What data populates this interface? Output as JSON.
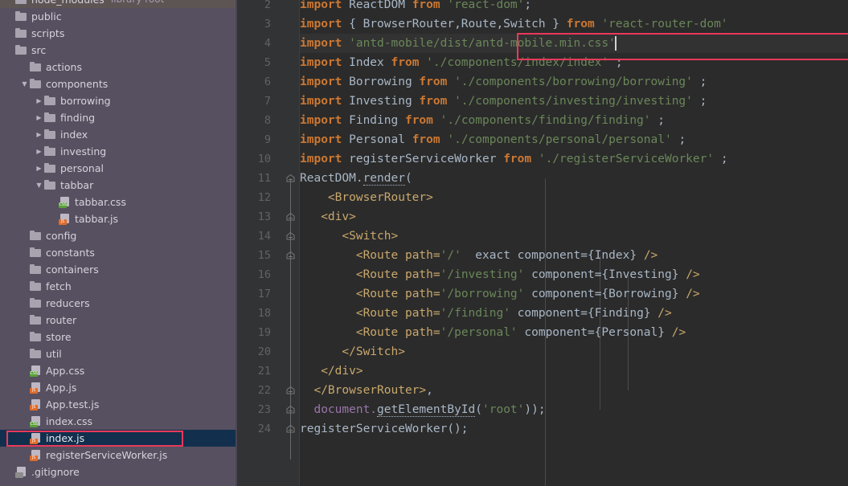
{
  "sidebar": {
    "name": "project-tree",
    "rows": [
      {
        "indent": 0,
        "twisty": "none",
        "icon": "folder-icon",
        "label": "node_modules",
        "sub": "library root",
        "state": "library-root",
        "partial_top": true
      },
      {
        "indent": 0,
        "twisty": "none",
        "icon": "folder-icon",
        "label": "public",
        "sub": "",
        "state": "normal"
      },
      {
        "indent": 0,
        "twisty": "none",
        "icon": "folder-icon",
        "label": "scripts",
        "sub": "",
        "state": "normal"
      },
      {
        "indent": 0,
        "twisty": "none",
        "icon": "folder-icon",
        "label": "src",
        "sub": "",
        "state": "normal"
      },
      {
        "indent": 1,
        "twisty": "none",
        "icon": "folder-icon",
        "label": "actions",
        "sub": "",
        "state": "normal"
      },
      {
        "indent": 1,
        "twisty": "expanded",
        "icon": "folder-icon",
        "label": "components",
        "sub": "",
        "state": "normal"
      },
      {
        "indent": 2,
        "twisty": "collapsed",
        "icon": "folder-icon",
        "label": "borrowing",
        "sub": "",
        "state": "normal"
      },
      {
        "indent": 2,
        "twisty": "collapsed",
        "icon": "folder-icon",
        "label": "finding",
        "sub": "",
        "state": "normal"
      },
      {
        "indent": 2,
        "twisty": "collapsed",
        "icon": "folder-icon",
        "label": "index",
        "sub": "",
        "state": "normal"
      },
      {
        "indent": 2,
        "twisty": "collapsed",
        "icon": "folder-icon",
        "label": "investing",
        "sub": "",
        "state": "normal"
      },
      {
        "indent": 2,
        "twisty": "collapsed",
        "icon": "folder-icon",
        "label": "personal",
        "sub": "",
        "state": "normal"
      },
      {
        "indent": 2,
        "twisty": "expanded",
        "icon": "folder-icon",
        "label": "tabbar",
        "sub": "",
        "state": "normal"
      },
      {
        "indent": 3,
        "twisty": "none",
        "icon": "css-file-icon",
        "label": "tabbar.css",
        "sub": "",
        "state": "normal"
      },
      {
        "indent": 3,
        "twisty": "none",
        "icon": "js-file-icon",
        "label": "tabbar.js",
        "sub": "",
        "state": "normal"
      },
      {
        "indent": 1,
        "twisty": "none",
        "icon": "folder-icon",
        "label": "config",
        "sub": "",
        "state": "normal"
      },
      {
        "indent": 1,
        "twisty": "none",
        "icon": "folder-icon",
        "label": "constants",
        "sub": "",
        "state": "normal"
      },
      {
        "indent": 1,
        "twisty": "none",
        "icon": "folder-icon",
        "label": "containers",
        "sub": "",
        "state": "normal"
      },
      {
        "indent": 1,
        "twisty": "none",
        "icon": "folder-icon",
        "label": "fetch",
        "sub": "",
        "state": "normal"
      },
      {
        "indent": 1,
        "twisty": "none",
        "icon": "folder-icon",
        "label": "reducers",
        "sub": "",
        "state": "normal"
      },
      {
        "indent": 1,
        "twisty": "none",
        "icon": "folder-icon",
        "label": "router",
        "sub": "",
        "state": "normal"
      },
      {
        "indent": 1,
        "twisty": "none",
        "icon": "folder-icon",
        "label": "store",
        "sub": "",
        "state": "normal"
      },
      {
        "indent": 1,
        "twisty": "none",
        "icon": "folder-icon",
        "label": "util",
        "sub": "",
        "state": "normal"
      },
      {
        "indent": 1,
        "twisty": "none",
        "icon": "css-file-icon",
        "label": "App.css",
        "sub": "",
        "state": "normal"
      },
      {
        "indent": 1,
        "twisty": "none",
        "icon": "js-file-icon",
        "label": "App.js",
        "sub": "",
        "state": "normal"
      },
      {
        "indent": 1,
        "twisty": "none",
        "icon": "js-test-file-icon",
        "label": "App.test.js",
        "sub": "",
        "state": "normal"
      },
      {
        "indent": 1,
        "twisty": "none",
        "icon": "css-file-icon",
        "label": "index.css",
        "sub": "",
        "state": "normal"
      },
      {
        "indent": 1,
        "twisty": "none",
        "icon": "js-file-icon",
        "label": "index.js",
        "sub": "",
        "state": "selected"
      },
      {
        "indent": 1,
        "twisty": "none",
        "icon": "js-file-icon",
        "label": "registerServiceWorker.js",
        "sub": "",
        "state": "normal"
      },
      {
        "indent": 0,
        "twisty": "none",
        "icon": "file-icon",
        "label": ".gitignore",
        "sub": "",
        "state": "normal",
        "partial_bottom": true
      }
    ],
    "annotation": {
      "name": "tree-selection-annotation",
      "color": "#e8395b"
    }
  },
  "editor": {
    "name": "code-editor",
    "first_visible_line": 2,
    "caret_line": 4,
    "annotation": {
      "name": "code-line-annotation",
      "color": "#e8395b",
      "line": 4
    },
    "lines": [
      {
        "no": "2",
        "tokens": [
          {
            "t": "kw",
            "v": "import"
          },
          {
            "t": "def",
            "v": " ReactDOM "
          },
          {
            "t": "kw",
            "v": "from"
          },
          {
            "t": "def",
            "v": " "
          },
          {
            "t": "str",
            "v": "'react-dom'"
          },
          {
            "t": "punc",
            "v": ";"
          }
        ]
      },
      {
        "no": "3",
        "tokens": [
          {
            "t": "kw",
            "v": "import"
          },
          {
            "t": "def",
            "v": " { BrowserRouter,Route,Switch } "
          },
          {
            "t": "kw",
            "v": "from"
          },
          {
            "t": "def",
            "v": " "
          },
          {
            "t": "str",
            "v": "'react-router-dom'"
          }
        ]
      },
      {
        "no": "4",
        "tokens": [
          {
            "t": "kw",
            "v": "import"
          },
          {
            "t": "def",
            "v": " "
          },
          {
            "t": "str",
            "v": "'antd-mobile/dist/antd-mobile.min.css'"
          }
        ]
      },
      {
        "no": "5",
        "tokens": [
          {
            "t": "kw",
            "v": "import"
          },
          {
            "t": "def",
            "v": " Index "
          },
          {
            "t": "kw",
            "v": "from"
          },
          {
            "t": "def",
            "v": " "
          },
          {
            "t": "str",
            "v": "'./components/index/index'"
          },
          {
            "t": "punc",
            "v": " ;"
          }
        ]
      },
      {
        "no": "6",
        "tokens": [
          {
            "t": "kw",
            "v": "import"
          },
          {
            "t": "def",
            "v": " Borrowing "
          },
          {
            "t": "kw",
            "v": "from"
          },
          {
            "t": "def",
            "v": " "
          },
          {
            "t": "str",
            "v": "'./components/borrowing/borrowing'"
          },
          {
            "t": "punc",
            "v": " ;"
          }
        ]
      },
      {
        "no": "7",
        "tokens": [
          {
            "t": "kw",
            "v": "import"
          },
          {
            "t": "def",
            "v": " Investing "
          },
          {
            "t": "kw",
            "v": "from"
          },
          {
            "t": "def",
            "v": " "
          },
          {
            "t": "str",
            "v": "'./components/investing/investing'"
          },
          {
            "t": "punc",
            "v": " ;"
          }
        ]
      },
      {
        "no": "8",
        "tokens": [
          {
            "t": "kw",
            "v": "import"
          },
          {
            "t": "def",
            "v": " Finding "
          },
          {
            "t": "kw",
            "v": "from"
          },
          {
            "t": "def",
            "v": " "
          },
          {
            "t": "str",
            "v": "'./components/finding/finding'"
          },
          {
            "t": "punc",
            "v": " ;"
          }
        ]
      },
      {
        "no": "9",
        "tokens": [
          {
            "t": "kw",
            "v": "import"
          },
          {
            "t": "def",
            "v": " Personal "
          },
          {
            "t": "kw",
            "v": "from"
          },
          {
            "t": "def",
            "v": " "
          },
          {
            "t": "str",
            "v": "'./components/personal/personal'"
          },
          {
            "t": "punc",
            "v": " ;"
          }
        ]
      },
      {
        "no": "10",
        "tokens": [
          {
            "t": "kw",
            "v": "import"
          },
          {
            "t": "def",
            "v": " registerServiceWorker "
          },
          {
            "t": "kw",
            "v": "from"
          },
          {
            "t": "def",
            "v": " "
          },
          {
            "t": "str",
            "v": "'./registerServiceWorker'"
          },
          {
            "t": "punc",
            "v": " ;"
          }
        ]
      },
      {
        "no": "11",
        "tokens": [
          {
            "t": "def",
            "v": "ReactDOM."
          },
          {
            "t": "wavy",
            "v": "render"
          },
          {
            "t": "punc",
            "v": "("
          }
        ]
      },
      {
        "no": "12",
        "tokens": [
          {
            "t": "def",
            "v": "    "
          },
          {
            "t": "tag",
            "v": "<BrowserRouter>"
          }
        ]
      },
      {
        "no": "13",
        "tokens": [
          {
            "t": "def",
            "v": "   "
          },
          {
            "t": "tag",
            "v": "<div>"
          }
        ]
      },
      {
        "no": "14",
        "tokens": [
          {
            "t": "def",
            "v": "      "
          },
          {
            "t": "tag",
            "v": "<Switch>"
          }
        ]
      },
      {
        "no": "15",
        "tokens": [
          {
            "t": "def",
            "v": "        "
          },
          {
            "t": "tag",
            "v": "<Route"
          },
          {
            "t": "def",
            "v": " "
          },
          {
            "t": "tag",
            "v": "path="
          },
          {
            "t": "str",
            "v": "'/'"
          },
          {
            "t": "def",
            "v": "  exact component={Index} "
          },
          {
            "t": "tag",
            "v": "/>"
          }
        ]
      },
      {
        "no": "16",
        "tokens": [
          {
            "t": "def",
            "v": "        "
          },
          {
            "t": "tag",
            "v": "<Route"
          },
          {
            "t": "def",
            "v": " "
          },
          {
            "t": "tag",
            "v": "path="
          },
          {
            "t": "str",
            "v": "'/investing'"
          },
          {
            "t": "def",
            "v": " component={Investing} "
          },
          {
            "t": "tag",
            "v": "/>"
          }
        ]
      },
      {
        "no": "17",
        "tokens": [
          {
            "t": "def",
            "v": "        "
          },
          {
            "t": "tag",
            "v": "<Route"
          },
          {
            "t": "def",
            "v": " "
          },
          {
            "t": "tag",
            "v": "path="
          },
          {
            "t": "str",
            "v": "'/borrowing'"
          },
          {
            "t": "def",
            "v": " component={Borrowing} "
          },
          {
            "t": "tag",
            "v": "/>"
          }
        ]
      },
      {
        "no": "18",
        "tokens": [
          {
            "t": "def",
            "v": "        "
          },
          {
            "t": "tag",
            "v": "<Route"
          },
          {
            "t": "def",
            "v": " "
          },
          {
            "t": "tag",
            "v": "path="
          },
          {
            "t": "str",
            "v": "'/finding'"
          },
          {
            "t": "def",
            "v": " component={Finding} "
          },
          {
            "t": "tag",
            "v": "/>"
          }
        ]
      },
      {
        "no": "19",
        "tokens": [
          {
            "t": "def",
            "v": "        "
          },
          {
            "t": "tag",
            "v": "<Route"
          },
          {
            "t": "def",
            "v": " "
          },
          {
            "t": "tag",
            "v": "path="
          },
          {
            "t": "str",
            "v": "'/personal'"
          },
          {
            "t": "def",
            "v": " component={Personal} "
          },
          {
            "t": "tag",
            "v": "/>"
          }
        ]
      },
      {
        "no": "20",
        "tokens": [
          {
            "t": "def",
            "v": "      "
          },
          {
            "t": "tag",
            "v": "</Switch>"
          }
        ]
      },
      {
        "no": "21",
        "tokens": [
          {
            "t": "def",
            "v": "   "
          },
          {
            "t": "tag",
            "v": "</div>"
          }
        ]
      },
      {
        "no": "22",
        "tokens": [
          {
            "t": "def",
            "v": "  "
          },
          {
            "t": "tag",
            "v": "</BrowserRouter>"
          },
          {
            "t": "punc",
            "v": ","
          }
        ]
      },
      {
        "no": "23",
        "tokens": [
          {
            "t": "def",
            "v": "  "
          },
          {
            "t": "obj",
            "v": "document."
          },
          {
            "t": "wavy",
            "v": "getElementById"
          },
          {
            "t": "punc",
            "v": "("
          },
          {
            "t": "str",
            "v": "'root'"
          },
          {
            "t": "punc",
            "v": "));"
          }
        ]
      },
      {
        "no": "24",
        "tokens": [
          {
            "t": "def",
            "v": "registerServiceWorker"
          },
          {
            "t": "punc",
            "v": "();"
          }
        ]
      }
    ]
  },
  "colors": {
    "sidebar_bg": "#575060",
    "editor_bg": "#2b2b2b",
    "gutter_bg": "#313335",
    "selection_bg": "#12304d",
    "annotation_red": "#e8395b",
    "keyword_orange": "#cc7832",
    "string_green": "#6a8759",
    "tag_gold": "#c9a86c",
    "default_text": "#a9b7c6"
  }
}
